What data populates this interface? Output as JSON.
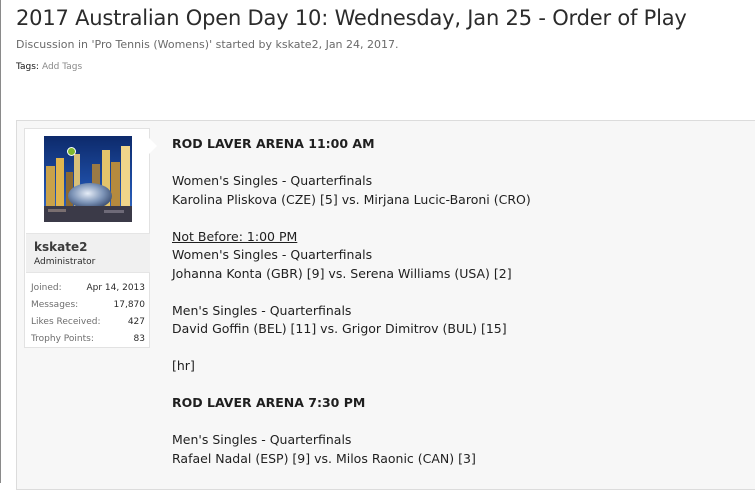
{
  "thread": {
    "title": "2017 Australian Open Day 10: Wednesday, Jan 25 - Order of Play",
    "meta_prefix": "Discussion in '",
    "forum": "Pro Tennis (Womens)",
    "meta_mid": "' started by ",
    "author": "kskate2",
    "meta_date": ", Jan 24, 2017.",
    "tags_label": "Tags:",
    "add_tags": "Add Tags"
  },
  "user": {
    "name": "kskate2",
    "title": "Administrator",
    "online_color": "#7fb92f",
    "stats": [
      {
        "label": "Joined:",
        "value": "Apr 14, 2013"
      },
      {
        "label": "Messages:",
        "value": "17,870"
      },
      {
        "label": "Likes Received:",
        "value": "427"
      },
      {
        "label": "Trophy Points:",
        "value": "83"
      }
    ]
  },
  "post": {
    "lines": [
      "ROD LAVER ARENA 11:00 AM",
      "Women's Singles - Quarterfinals",
      "Karolina Pliskova (CZE) [5] vs. Mirjana Lucic-Baroni (CRO)",
      "Not Before: 1:00 PM",
      "Women's Singles - Quarterfinals",
      "Johanna Konta (GBR) [9] vs. Serena Williams (USA) [2]",
      "Men's Singles - Quarterfinals",
      "David Goffin (BEL) [11] vs. Grigor Dimitrov (BUL) [15]",
      "[hr]",
      "ROD LAVER ARENA 7:30 PM",
      "Men's Singles - Quarterfinals",
      "Rafael Nadal (ESP) [9] vs. Milos Raonic (CAN) [3]"
    ]
  }
}
